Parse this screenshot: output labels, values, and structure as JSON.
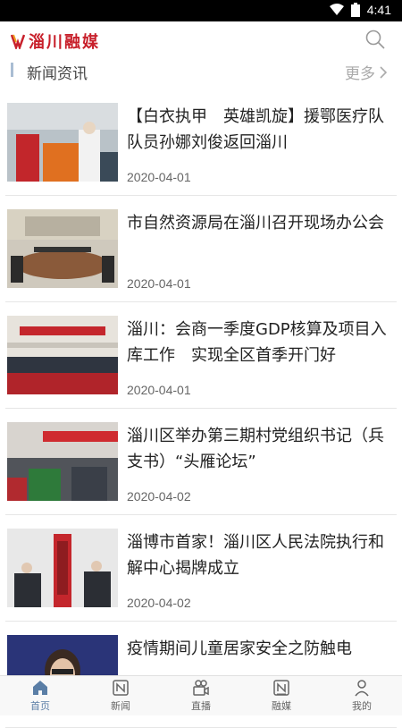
{
  "status": {
    "time": "4:41"
  },
  "app": {
    "logo_text": "淄川融媒"
  },
  "section": {
    "title": "新闻资讯",
    "more": "更多"
  },
  "news": [
    {
      "title": "【白衣执甲　英雄凯旋】援鄂医疗队队员孙娜刘俊返回淄川",
      "date": "2020-04-01"
    },
    {
      "title": "市自然资源局在淄川召开现场办公会",
      "date": "2020-04-01"
    },
    {
      "title": "淄川：会商一季度GDP核算及项目入库工作　实现全区首季开门好",
      "date": "2020-04-01"
    },
    {
      "title": "淄川区举办第三期村党组织书记（兵支书）“头雁论坛”",
      "date": "2020-04-02"
    },
    {
      "title": "淄博市首家！淄川区人民法院执行和解中心揭牌成立",
      "date": "2020-04-02"
    },
    {
      "title": "疫情期间儿童居家安全之防触电",
      "date": "2020-04-02"
    }
  ],
  "tabs": [
    "首页",
    "新闻",
    "直播",
    "融媒",
    "我的"
  ],
  "colors": {
    "active_tab": "#5a7ea6",
    "logo_red": "#c8202b"
  }
}
